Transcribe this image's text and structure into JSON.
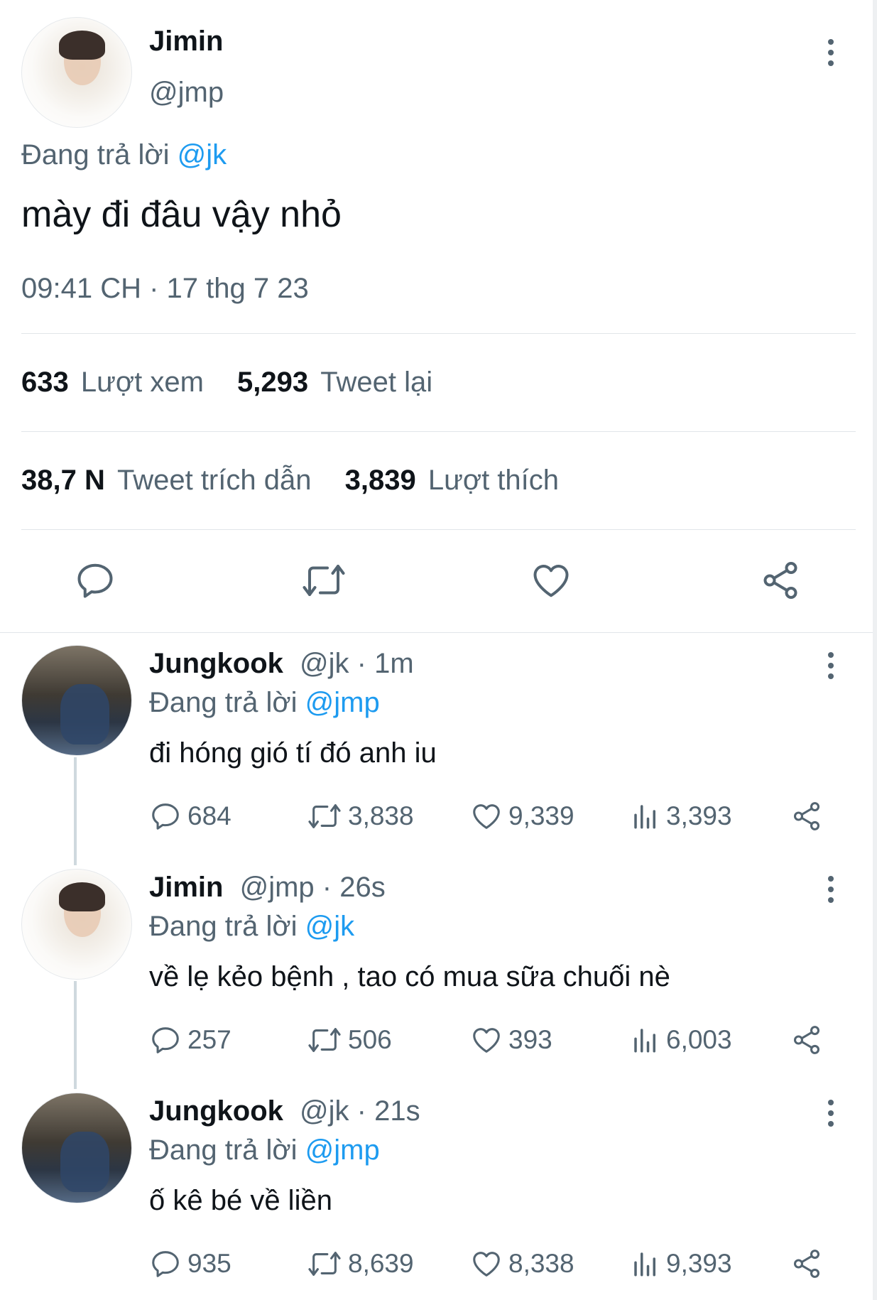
{
  "main": {
    "name": "Jimin",
    "handle": "@jmp",
    "replying_prefix": "Đang trả lời",
    "replying_to": "@jk",
    "text": "mày đi đâu vậy nhỏ",
    "time": "09:41 CH · 17 thg 7 23",
    "views_count": "633",
    "views_label": "Lượt xem",
    "retweets_count": "5,293",
    "retweets_label": "Tweet lại",
    "quotes_count": "38,7 N",
    "quotes_label": "Tweet trích dẫn",
    "likes_count": "3,839",
    "likes_label": "Lượt thích"
  },
  "replies": [
    {
      "name": "Jungkook",
      "handle": "@jk",
      "age": "· 1m",
      "replying_prefix": "Đang trả lời",
      "replying_to": "@jmp",
      "text": "đi hóng gió tí đó anh iu",
      "replies": "684",
      "retweets": "3,838",
      "likes": "9,339",
      "views": "3,393"
    },
    {
      "name": "Jimin",
      "handle": "@jmp",
      "age": "· 26s",
      "replying_prefix": "Đang trả lời",
      "replying_to": "@jk",
      "text": "về lẹ kẻo bệnh , tao có mua sữa chuối nè",
      "replies": "257",
      "retweets": "506",
      "likes": "393",
      "views": "6,003"
    },
    {
      "name": "Jungkook",
      "handle": "@jk",
      "age": "· 21s",
      "replying_prefix": "Đang trả lời",
      "replying_to": "@jmp",
      "text": "ố kê bé về liền",
      "replies": "935",
      "retweets": "8,639",
      "likes": "8,338",
      "views": "9,393"
    }
  ],
  "colors": {
    "text": "#0f1419",
    "secondary": "#536471",
    "accent": "#1d9bf0",
    "divider": "#e1e5e9"
  },
  "icons": [
    "more-icon",
    "reply-icon",
    "retweet-icon",
    "like-icon",
    "share-icon",
    "views-icon"
  ]
}
